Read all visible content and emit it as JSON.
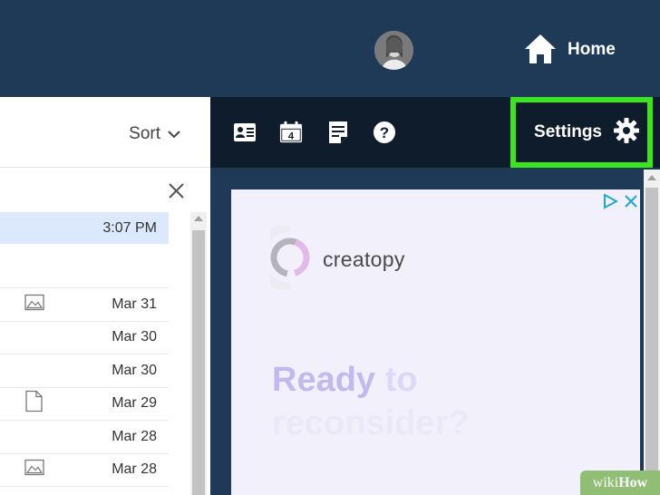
{
  "header": {
    "home_label": "Home"
  },
  "list_panel": {
    "sort_label": "Sort",
    "rows": [
      {
        "date": "3:07 PM",
        "icon": "",
        "selected": true
      },
      {
        "date": "",
        "icon": "",
        "selected": false
      },
      {
        "date": "Mar 31",
        "icon": "image-icon",
        "selected": false
      },
      {
        "date": "Mar 30",
        "icon": "",
        "selected": false
      },
      {
        "date": "Mar 30",
        "icon": "",
        "selected": false
      },
      {
        "date": "Mar 29",
        "icon": "document-icon",
        "selected": false
      },
      {
        "date": "Mar 28",
        "icon": "",
        "selected": false
      },
      {
        "date": "Mar 28",
        "icon": "image-icon",
        "selected": false
      }
    ]
  },
  "toolbar": {
    "calendar_day": "4",
    "settings_label": "Settings",
    "icons": [
      "contacts-icon",
      "calendar-icon",
      "notes-icon",
      "help-icon",
      "gear-icon"
    ]
  },
  "ad": {
    "brand": "creatopy",
    "headline_word1": "Ready",
    "headline_word2": "to",
    "headline_line2": "reconsider?"
  },
  "watermark": {
    "prefix": "wiki",
    "suffix": "How"
  },
  "colors": {
    "header_bg": "#1f3a56",
    "toolbar_bg": "#0f1c2b",
    "highlight": "#39e51c",
    "selected_row": "#dce8fb"
  }
}
